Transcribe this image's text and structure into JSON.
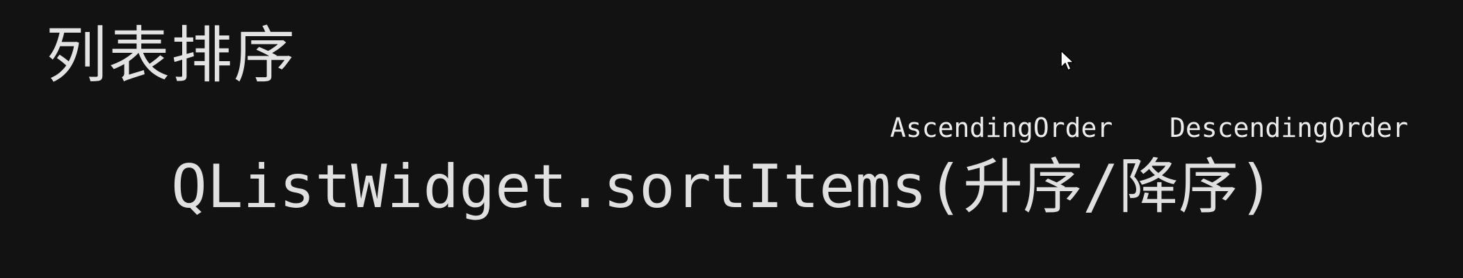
{
  "colors": {
    "background": "#121212",
    "text": "#e3e3e3"
  },
  "slide": {
    "title": "列表排序",
    "annotations": {
      "ascending": "AscendingOrder",
      "descending": "DescendingOrder"
    },
    "code": {
      "method": "QListWidget.sortItems",
      "open_paren": "(",
      "arg_ascending": "升序",
      "separator": "/",
      "arg_descending": "降序",
      "close_paren": ")"
    }
  },
  "cursor": {
    "icon": "mouse-pointer-icon"
  }
}
